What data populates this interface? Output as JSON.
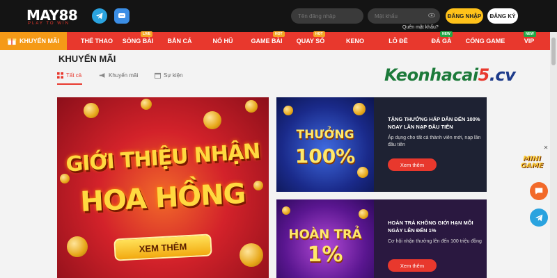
{
  "header": {
    "logo": "MAY88",
    "logo_tagline": "PLAY TO WIN",
    "username_placeholder": "Tên đăng nhập",
    "password_placeholder": "Mật khẩu",
    "forgot_password": "Quên mật khẩu?",
    "login_label": "ĐĂNG NHẬP",
    "register_label": "ĐĂNG KÝ"
  },
  "nav": {
    "promo": "KHUYẾN MÃI",
    "items": [
      {
        "label": "THỂ THAO",
        "badge": ""
      },
      {
        "label": "SÒNG BÀI",
        "badge": "LIVE"
      },
      {
        "label": "BẮN CÁ",
        "badge": ""
      },
      {
        "label": "NỔ HŨ",
        "badge": ""
      },
      {
        "label": "GAME BÀI",
        "badge": "HOT"
      },
      {
        "label": "QUAY SỐ",
        "badge": "HOT"
      },
      {
        "label": "KENO",
        "badge": ""
      },
      {
        "label": "LÔ ĐỀ",
        "badge": ""
      },
      {
        "label": "ĐÁ GÀ",
        "badge": "NEW"
      },
      {
        "label": "CỔNG GAME",
        "badge": ""
      },
      {
        "label": "VIP",
        "badge": "NEW"
      }
    ]
  },
  "page": {
    "title": "KHUYẾN MÃI",
    "tabs": [
      "Tất cả",
      "Khuyến mãi",
      "Sự kiện"
    ],
    "watermark": {
      "name": "Keonhacai",
      "num": "5",
      "dom": ".cv"
    }
  },
  "banner": {
    "line1": "GIỚI THIỆU NHẬN",
    "line2": "HOA HỒNG",
    "button": "XEM THÊM"
  },
  "promos": [
    {
      "art_line1": "THƯỞNG",
      "art_line2": "100%",
      "title": "TẶNG THƯỞNG HẤP DẪN ĐẾN 100% NGAY LẦN NẠP ĐẦU TIÊN",
      "desc": "Áp dụng cho tất cả thành viên mới, nạp lần đầu tiên",
      "button": "Xem thêm"
    },
    {
      "art_line1": "HOÀN TRẢ",
      "art_line2": "1%",
      "title": "HOÀN TRẢ KHÔNG GIỚI HẠN MỖI NGÀY LÊN ĐẾN 1%",
      "desc": "Cơ hội nhận thưởng lên đến 100 triệu đồng",
      "button": "Xem thêm"
    }
  ],
  "floating": {
    "mini_game": "MINI GAME"
  },
  "colors": {
    "accent": "#e8382d",
    "promo_orange": "#f59a17",
    "login_yellow": "#ffc21a",
    "header_dark": "#141414"
  }
}
